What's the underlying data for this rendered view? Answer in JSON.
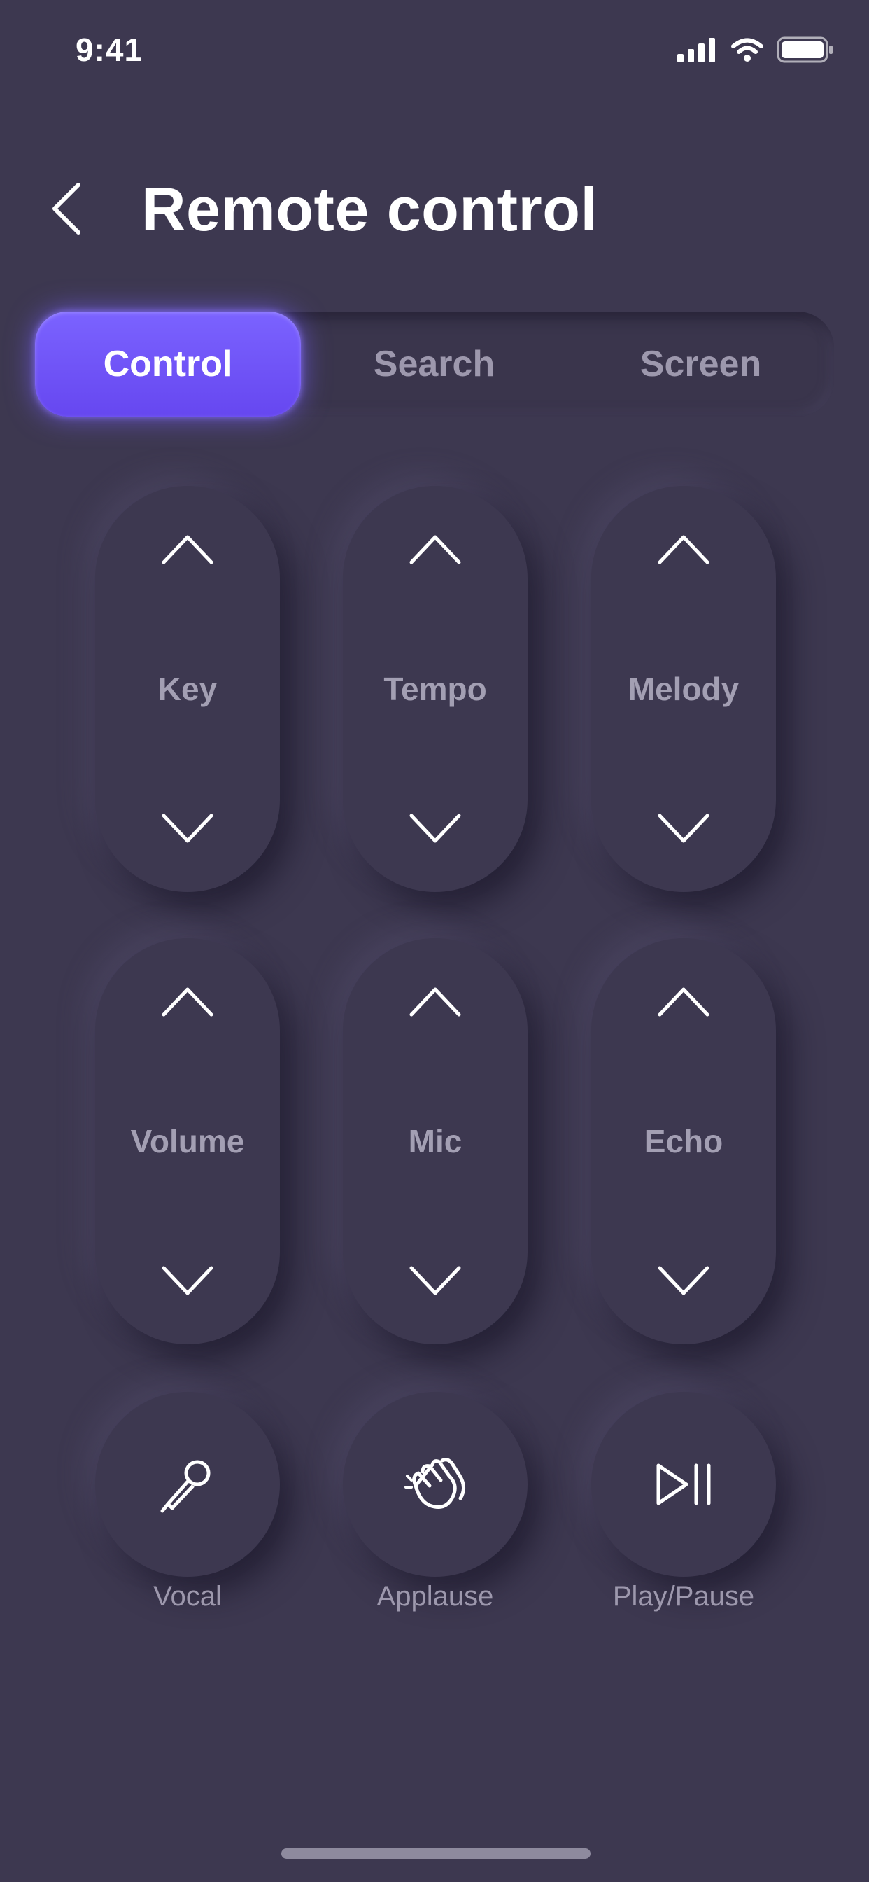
{
  "status": {
    "time": "9:41"
  },
  "header": {
    "title": "Remote control"
  },
  "tabs": [
    {
      "label": "Control",
      "active": true
    },
    {
      "label": "Search",
      "active": false
    },
    {
      "label": "Screen",
      "active": false
    }
  ],
  "controls": [
    {
      "label": "Key"
    },
    {
      "label": "Tempo"
    },
    {
      "label": "Melody"
    },
    {
      "label": "Volume"
    },
    {
      "label": "Mic"
    },
    {
      "label": "Echo"
    }
  ],
  "actions": [
    {
      "label": "Vocal",
      "icon": "microphone-icon"
    },
    {
      "label": "Applause",
      "icon": "clapping-hands-icon"
    },
    {
      "label": "Play/Pause",
      "icon": "play-pause-icon"
    }
  ],
  "colors": {
    "background": "#3d3850",
    "accent": "#6c4ff5"
  }
}
